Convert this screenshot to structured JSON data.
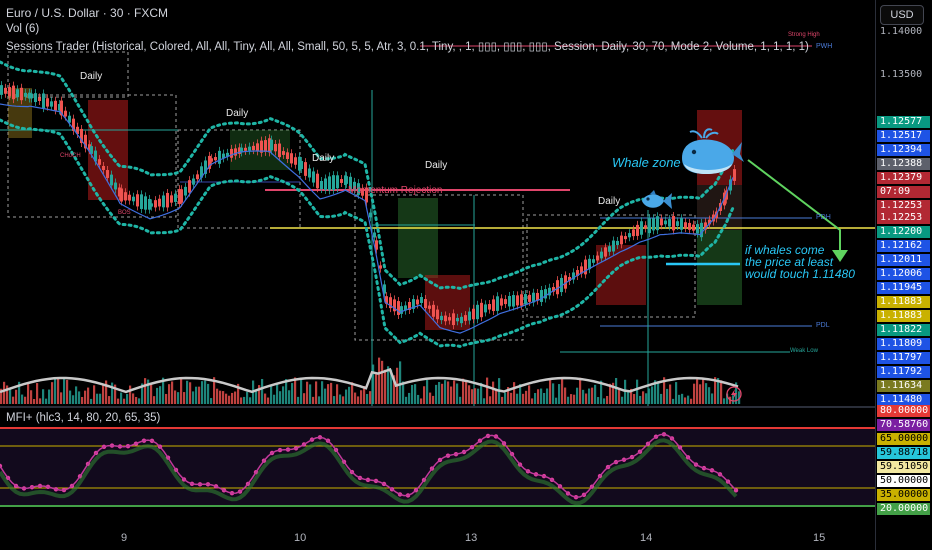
{
  "header": {
    "title": "Euro / U.S. Dollar · 30 · FXCM",
    "vol": "Vol (6)",
    "sessions": "Sessions Trader (Historical, Colored, All, All, Tiny, All, All, Small, 50, 5, 5, Atr, 3, 0.1, Tiny, , 1, ▯▯▯, ▯▯▯, ▯▯▯, Session, Daily, 30, 70, Mode 2, Volume, 1, 1, 1, 1)",
    "mfi": "MFI+ (hlc3, 14, 80, 20, 65, 35)"
  },
  "currency": "USD",
  "price_axis": {
    "plain": [
      "1.14000",
      "1.13500"
    ],
    "tags": [
      {
        "v": "1.12577",
        "bg": "#089981"
      },
      {
        "v": "1.12517",
        "bg": "#1e53e5"
      },
      {
        "v": "1.12394",
        "bg": "#1e53e5"
      },
      {
        "v": "1.12388",
        "bg": "#5d606b"
      },
      {
        "v": "1.12379",
        "bg": "#b22833"
      },
      {
        "v": "07:09",
        "bg": "#b22833"
      },
      {
        "v": "1.12253",
        "bg": "#b22833"
      },
      {
        "v": "1.12253",
        "bg": "#b22833"
      },
      {
        "v": "1.12200",
        "bg": "#089981"
      },
      {
        "v": "1.12162",
        "bg": "#1e53e5"
      },
      {
        "v": "1.12011",
        "bg": "#1e53e5"
      },
      {
        "v": "1.12006",
        "bg": "#1e53e5"
      },
      {
        "v": "1.11945",
        "bg": "#1e53e5"
      },
      {
        "v": "1.11883",
        "bg": "#c9b100"
      },
      {
        "v": "1.11883",
        "bg": "#c9b100"
      },
      {
        "v": "1.11822",
        "bg": "#089981"
      },
      {
        "v": "1.11809",
        "bg": "#1e53e5"
      },
      {
        "v": "1.11797",
        "bg": "#1e53e5"
      },
      {
        "v": "1.11792",
        "bg": "#1e53e5"
      },
      {
        "v": "1.11634",
        "bg": "#7a7a1f"
      },
      {
        "v": "1.11480",
        "bg": "#1e53e5"
      }
    ]
  },
  "mfi_axis": [
    {
      "v": "80.00000",
      "bg": "#e53935",
      "fg": "#ffffff"
    },
    {
      "v": "70.58760",
      "bg": "#7b1fa2",
      "fg": "#ffffff"
    },
    {
      "v": "65.00000",
      "bg": "#c9b100",
      "fg": "#000000"
    },
    {
      "v": "59.88718",
      "bg": "#26c6da",
      "fg": "#000000"
    },
    {
      "v": "59.51050",
      "bg": "#f2e8a0",
      "fg": "#000000"
    },
    {
      "v": "50.00000",
      "bg": "#ffffff",
      "fg": "#000000"
    },
    {
      "v": "35.00000",
      "bg": "#c9b100",
      "fg": "#000000"
    },
    {
      "v": "20.00000",
      "bg": "#43a047",
      "fg": "#ffffff"
    }
  ],
  "time_axis": [
    "9",
    "10",
    "13",
    "14",
    "15"
  ],
  "annotations": {
    "whale_zone": "Whale zone",
    "whale_note_1": "if whales come",
    "whale_note_2": "the price at least",
    "whale_note_3": "would touch 1.11480",
    "daily": [
      "Daily",
      "Daily",
      "Daily",
      "Daily",
      "Daily"
    ],
    "momentum": "Momentum Rejection",
    "pwh": "PWH",
    "pdh": "PDH",
    "pdl": "PDL",
    "strong_high": "Strong High",
    "weak_low": "Weak Low",
    "choch": "CHoCH",
    "bos": "BOS"
  },
  "icons": {
    "whale": "whale-icon",
    "fish": "fish-icon",
    "bolt": "lightning-icon"
  }
}
